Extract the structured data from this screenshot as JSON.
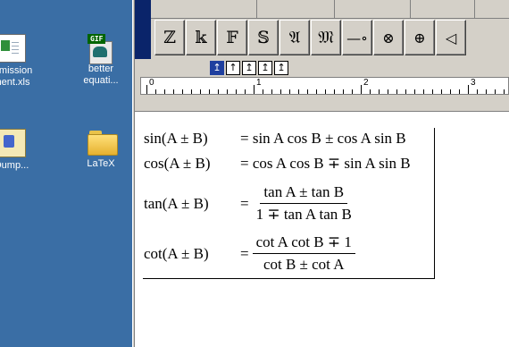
{
  "desktop": {
    "icons": [
      {
        "label1": "mmission",
        "label2": "ment.xls"
      },
      {
        "badge": "GIF",
        "label1": "better",
        "label2": "equati..."
      },
      {
        "label1": "Dump..."
      },
      {
        "label1": "LaTeX"
      }
    ]
  },
  "palette": {
    "buttons": [
      "ℤ",
      "𝕜",
      "𝔽",
      "𝕊",
      "𝔄",
      "𝔐",
      "—∘",
      "⊗",
      "⊕",
      "◁"
    ]
  },
  "nudge": {
    "buttons": [
      "↥",
      "↑",
      "↥",
      "↥",
      "↥"
    ]
  },
  "ruler": {
    "labels": [
      "0",
      "1",
      "2",
      "3"
    ]
  },
  "equations": [
    {
      "lhs": "sin(A ± B)",
      "rhs": "= sin A cos B ± cos A sin B"
    },
    {
      "lhs": "cos(A ± B)",
      "rhs": "= cos A cos B ∓ sin A sin B"
    },
    {
      "lhs": "tan(A ± B)",
      "eq": "=",
      "num": "tan A ± tan B",
      "den": "1 ∓ tan A tan B"
    },
    {
      "lhs": "cot(A ± B)",
      "eq": "=",
      "num": "cot A cot B ∓ 1",
      "den": "cot B ± cot A"
    }
  ]
}
